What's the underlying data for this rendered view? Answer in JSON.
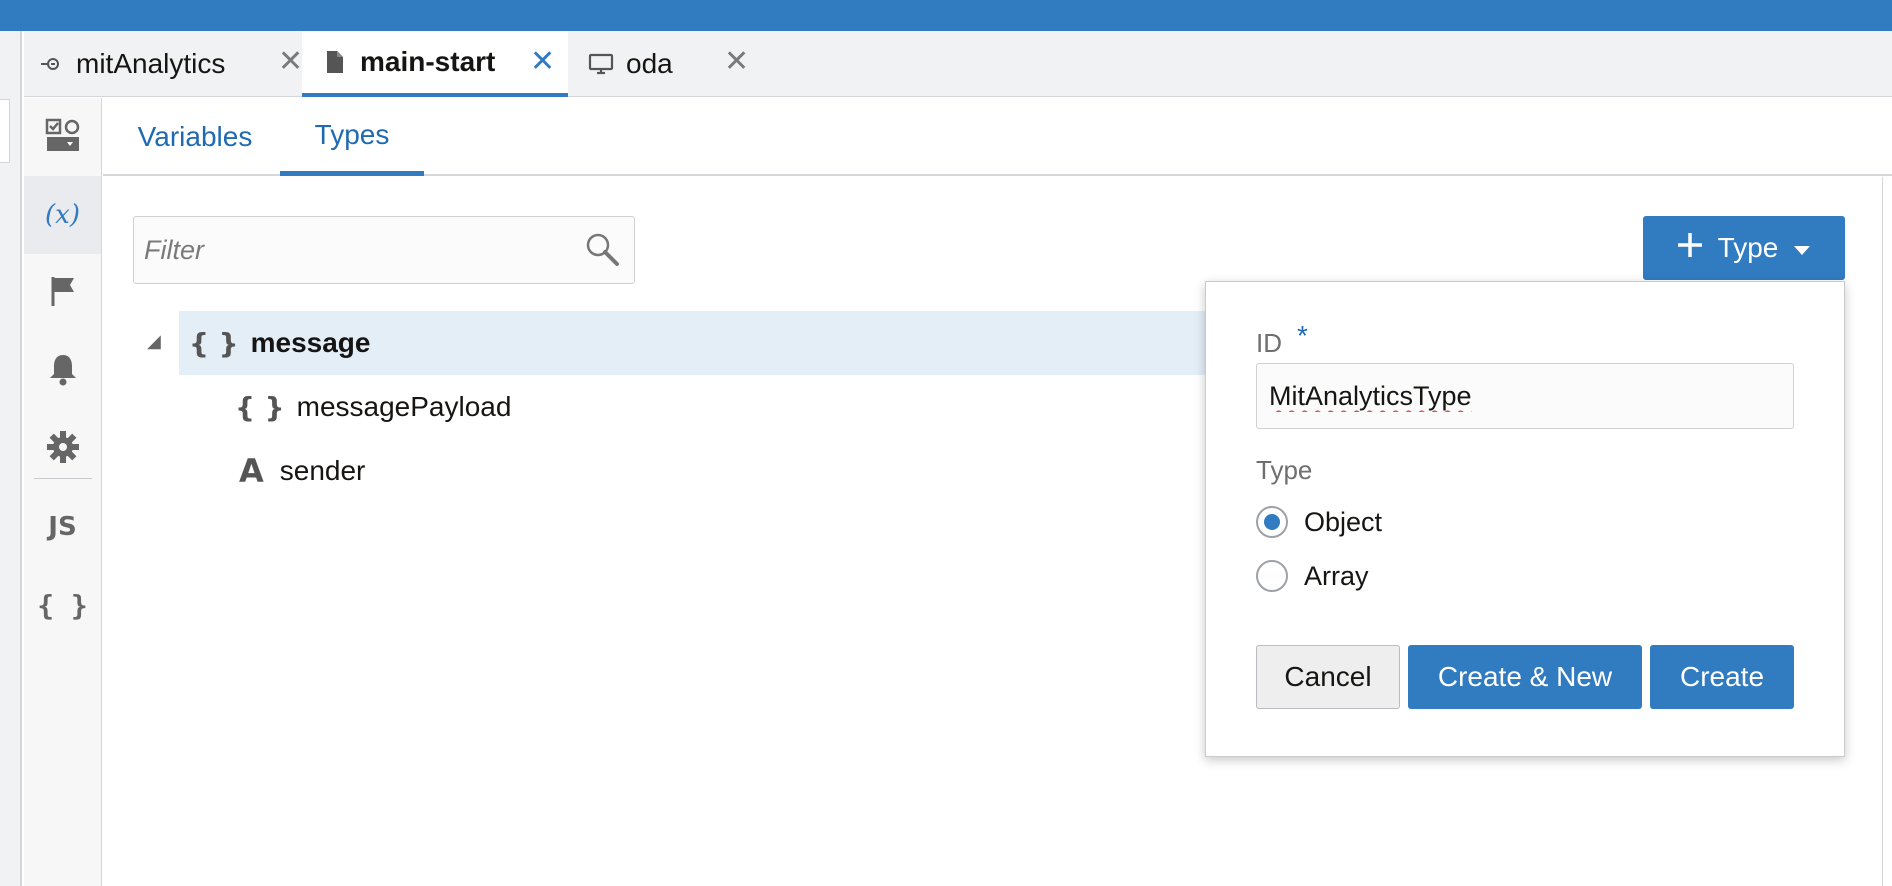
{
  "tabs": [
    {
      "label": "mitAnalytics",
      "icon": "skill-icon",
      "active": false
    },
    {
      "label": "main-start",
      "icon": "document-icon",
      "active": true
    },
    {
      "label": "oda",
      "icon": "monitor-icon",
      "active": false
    }
  ],
  "tab_close_glyph": "✕",
  "sidebar": {
    "items": [
      {
        "name": "flows",
        "icon": "flow-designer-icon",
        "active": false
      },
      {
        "name": "variables",
        "icon": "variables-icon",
        "glyph": "(x)",
        "active": true
      },
      {
        "name": "events",
        "icon": "flag-icon",
        "active": false
      },
      {
        "name": "notifications",
        "icon": "bell-icon",
        "active": false
      },
      {
        "name": "settings",
        "icon": "gear-icon",
        "active": false
      },
      {
        "name": "custom-components",
        "icon": "js-icon",
        "glyph": "JS",
        "active": false
      },
      {
        "name": "types",
        "icon": "braces-icon",
        "glyph": "{ }",
        "active": false
      }
    ]
  },
  "subtabs": [
    {
      "label": "Variables",
      "active": false
    },
    {
      "label": "Types",
      "active": true
    }
  ],
  "filter": {
    "placeholder": "Filter",
    "value": ""
  },
  "tree": {
    "root": {
      "label": "message",
      "icon_glyph": "{ }",
      "expanded": true,
      "selected": true
    },
    "children": [
      {
        "label": "messagePayload",
        "icon_glyph": "{ }",
        "icon": "object-type-icon"
      },
      {
        "label": "sender",
        "icon_glyph": "A",
        "icon": "string-type-icon"
      }
    ]
  },
  "add_type_button": {
    "label": "Type",
    "icon": "plus-icon",
    "caret": "caret-down-icon"
  },
  "popup": {
    "id_label": "ID",
    "required_marker": "*",
    "id_value": "MitAnalyticsType",
    "type_label": "Type",
    "options": [
      {
        "label": "Object",
        "checked": true
      },
      {
        "label": "Array",
        "checked": false
      }
    ],
    "cancel_label": "Cancel",
    "create_new_label": "Create & New",
    "create_label": "Create"
  },
  "colors": {
    "accent": "#317bc1",
    "link": "#1f6ab0",
    "selected_row": "#e4eef7"
  }
}
